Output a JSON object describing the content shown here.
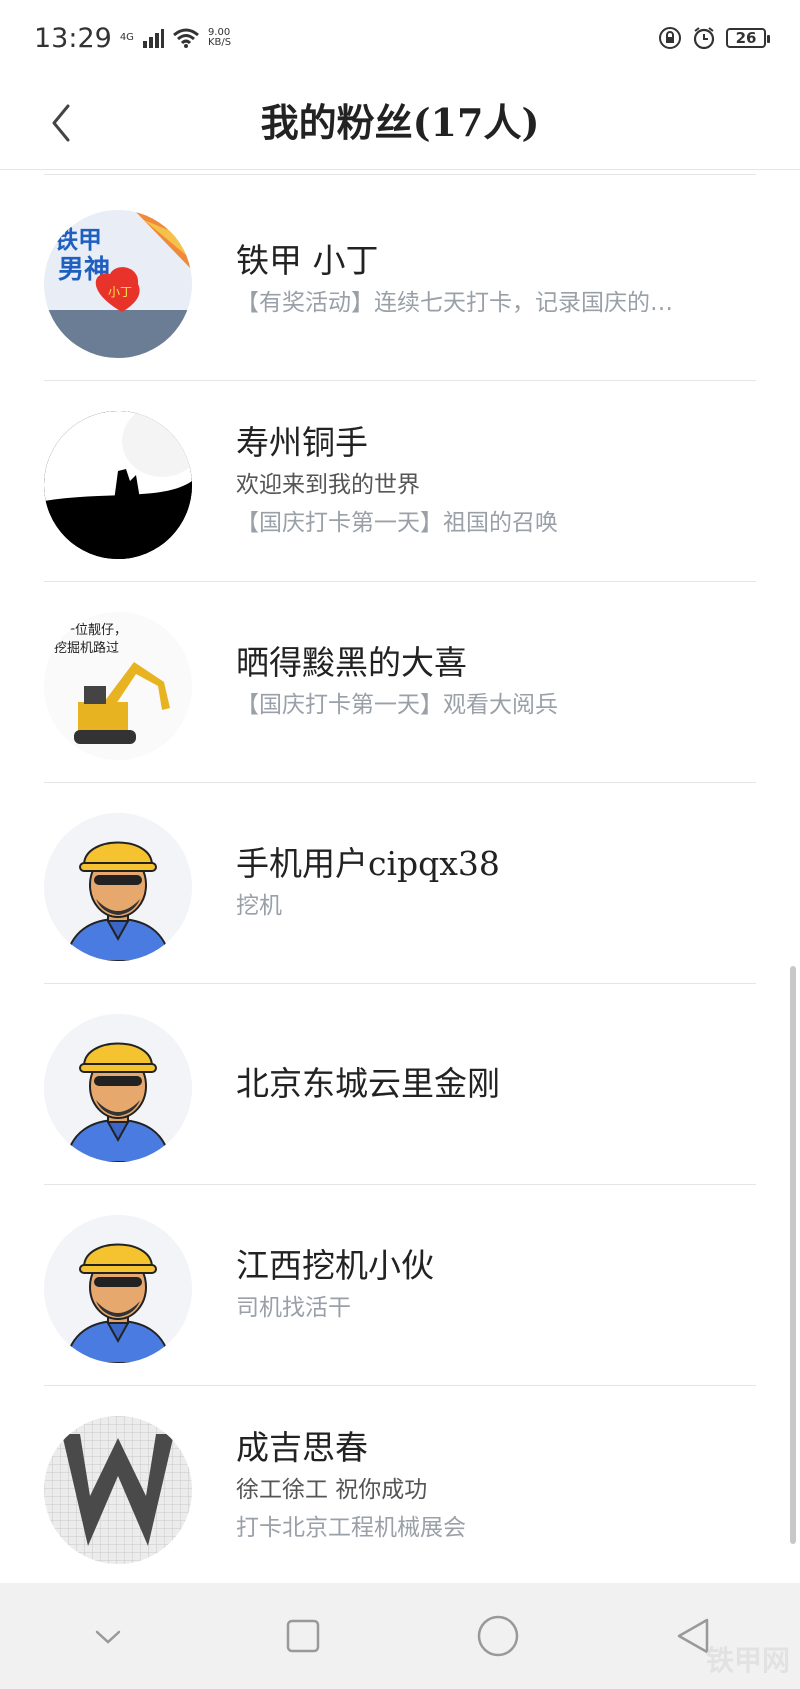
{
  "status_bar": {
    "time": "13:29",
    "network": "4G",
    "speed_value": "9.00",
    "speed_unit": "KB/S",
    "battery": "26"
  },
  "header": {
    "title": "我的粉丝(17人)"
  },
  "followers": [
    {
      "name": "铁甲 小丁",
      "lines": [
        {
          "text": "【有奖活动】连续七天打卡，记录国庆的…",
          "grey": true
        }
      ],
      "avatar_text1": "铁甲",
      "avatar_text2": "男神",
      "avatar_badge": "小丁"
    },
    {
      "name": "寿州铜手",
      "lines": [
        {
          "text": "欢迎来到我的世界",
          "grey": false
        },
        {
          "text": "【国庆打卡第一天】祖国的召唤",
          "grey": true
        }
      ]
    },
    {
      "name": "晒得黢黑的大喜",
      "lines": [
        {
          "text": "【国庆打卡第一天】观看大阅兵",
          "grey": true
        }
      ],
      "avatar_text1": "一位靓仔，",
      "avatar_text2": "挖掘机路过"
    },
    {
      "name": "手机用户cipqx38",
      "lines": [
        {
          "text": "挖机",
          "grey": true
        }
      ]
    },
    {
      "name": "北京东城云里金刚",
      "lines": []
    },
    {
      "name": "江西挖机小伙",
      "lines": [
        {
          "text": "司机找活干",
          "grey": true
        }
      ]
    },
    {
      "name": "成吉思春",
      "lines": [
        {
          "text": "徐工徐工 祝你成功",
          "grey": false
        },
        {
          "text": "打卡北京工程机械展会",
          "grey": true
        }
      ]
    }
  ],
  "watermark": "铁甲网",
  "colors": {
    "accent_grey": "#9aa0a8",
    "helmet": "#f5c230",
    "shirt": "#4a7be0"
  }
}
